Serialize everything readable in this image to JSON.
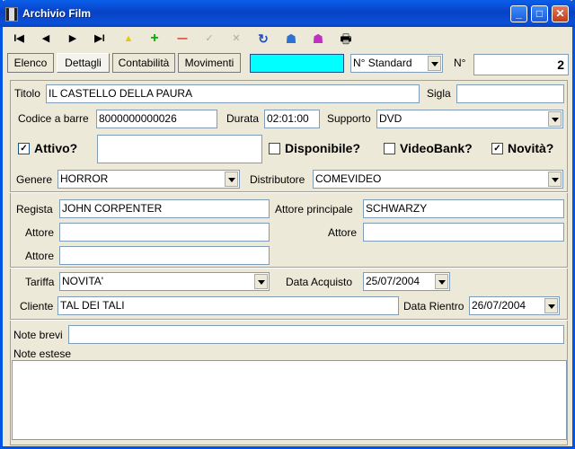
{
  "window": {
    "title": "Archivio Film",
    "minimize": "_",
    "maximize": "□",
    "close": "✕"
  },
  "toolbar": {
    "first": "I◀",
    "prev": "◀",
    "next": "▶",
    "last": "▶I",
    "mark": "▲",
    "add": "+",
    "remove": "—",
    "confirm": "✓",
    "cancel": "✕",
    "refresh": "↻",
    "search1": "☗",
    "search2": "☗",
    "print": "🖶"
  },
  "tabs": [
    "Elenco",
    "Dettagli",
    "Contabilità",
    "Movimenti"
  ],
  "header": {
    "search_value": "",
    "numbering_option": "N° Standard",
    "number_label": "N°",
    "number_value": "2"
  },
  "form": {
    "titolo_label": "Titolo",
    "titolo": "IL CASTELLO DELLA PAURA",
    "sigla_label": "Sigla",
    "sigla": "",
    "barcode_label": "Codice a barre",
    "barcode": "8000000000026",
    "durata_label": "Durata",
    "durata": "02:01:00",
    "supporto_label": "Supporto",
    "supporto": "DVD",
    "attivo_label": "Attivo?",
    "attivo": true,
    "attivo_note": "",
    "disponibile_label": "Disponibile?",
    "disponibile": false,
    "videobank_label": "VideoBank?",
    "videobank": false,
    "novita_label": "Novità?",
    "novita": true,
    "genere_label": "Genere",
    "genere": "HORROR",
    "distributore_label": "Distributore",
    "distributore": "COMEVIDEO",
    "regista_label": "Regista",
    "regista": "JOHN CORPENTER",
    "attore_principale_label": "Attore principale",
    "attore_principale": "SCHWARZY",
    "attore_label": "Attore",
    "attore1": "",
    "attore2": "",
    "attore3": "",
    "tariffa_label": "Tariffa",
    "tariffa": "NOVITA'",
    "data_acquisto_label": "Data Acquisto",
    "data_acquisto": "25/07/2004",
    "cliente_label": "Cliente",
    "cliente": "TAL DEI TALI",
    "data_rientro_label": "Data Rientro",
    "data_rientro": "26/07/2004",
    "note_brevi_label": "Note brevi",
    "note_brevi": "",
    "note_estese_label": "Note estese",
    "note_estese": ""
  }
}
